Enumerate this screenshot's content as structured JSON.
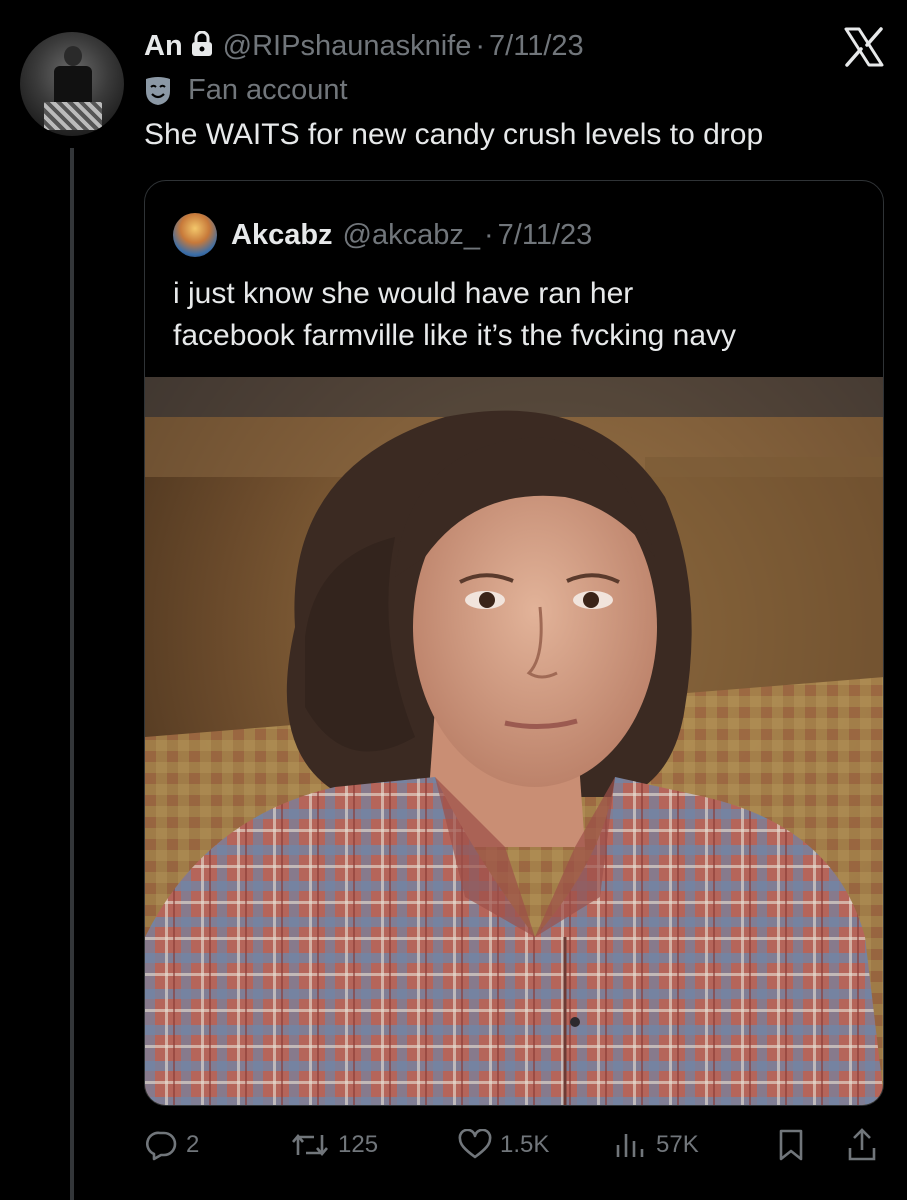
{
  "tweet": {
    "author_name": "An",
    "handle": "@RIPshaunasknife",
    "separator": "·",
    "date": "7/11/23",
    "label": "Fan account",
    "text": "She WAITS for new candy crush levels to drop"
  },
  "quoted": {
    "author_name": "Akcabz",
    "handle": "@akcabz_",
    "separator": "·",
    "date": "7/11/23",
    "text_line1": "i just know she would have ran her",
    "text_line2": "facebook farmville like it’s the fvcking navy"
  },
  "actions": {
    "replies": "2",
    "retweets": "125",
    "likes": "1.5K",
    "views": "57K"
  },
  "icons": [
    "lock-icon",
    "x-logo-icon",
    "mask-icon",
    "reply-icon",
    "retweet-icon",
    "like-icon",
    "views-icon",
    "bookmark-icon",
    "share-icon"
  ],
  "colors": {
    "background": "#000000",
    "text": "#e7e9ea",
    "secondary_text": "#71767b",
    "border": "#2f3336"
  }
}
